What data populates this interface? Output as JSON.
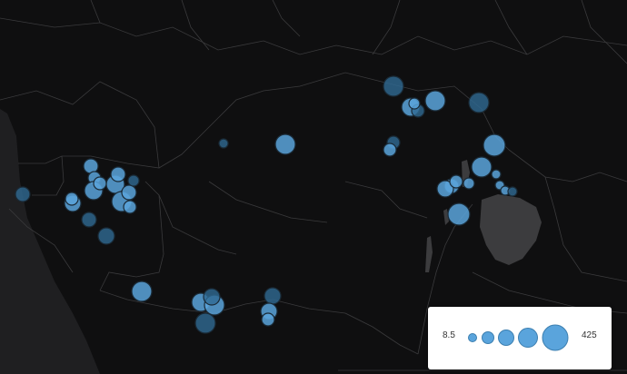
{
  "map": {
    "theme": "dark",
    "bubble_color": "#5aa4dc",
    "dark_bubble_color": "#2f6a94"
  },
  "legend": {
    "min_label": "8.5",
    "max_label": "425"
  }
}
